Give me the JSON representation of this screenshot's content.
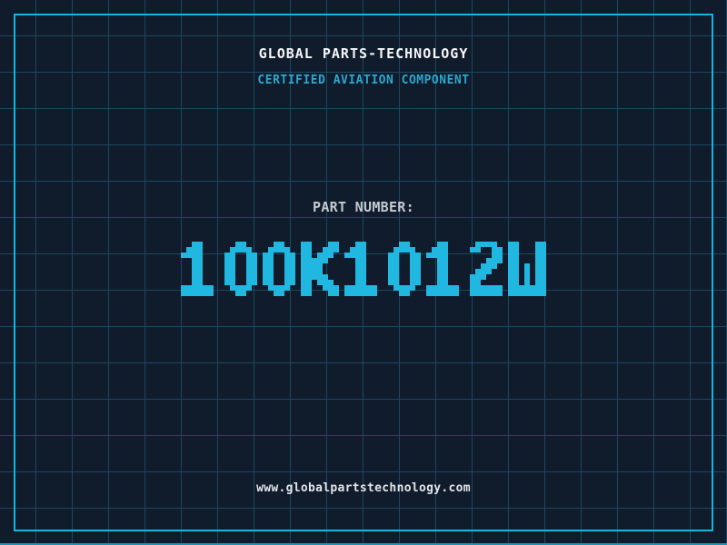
{
  "header": {
    "title": "GLOBAL PARTS-TECHNOLOGY",
    "subtitle": "CERTIFIED AVIATION COMPONENT"
  },
  "part": {
    "label": "PART NUMBER:",
    "number": "100K1012W"
  },
  "footer": {
    "website": "www.globalpartstechnology.com"
  },
  "colors": {
    "background": "#101b2b",
    "grid_line": "#1c4761",
    "frame_cyan": "#12b6e0",
    "part_number_cyan": "#20b8e0",
    "subtitle_cyan": "#2ba8ce",
    "title_white": "#f4f6f8",
    "label_gray": "#c5cad2",
    "footer_white": "#e2e6ea",
    "bottom_edge": "#1795b8"
  }
}
